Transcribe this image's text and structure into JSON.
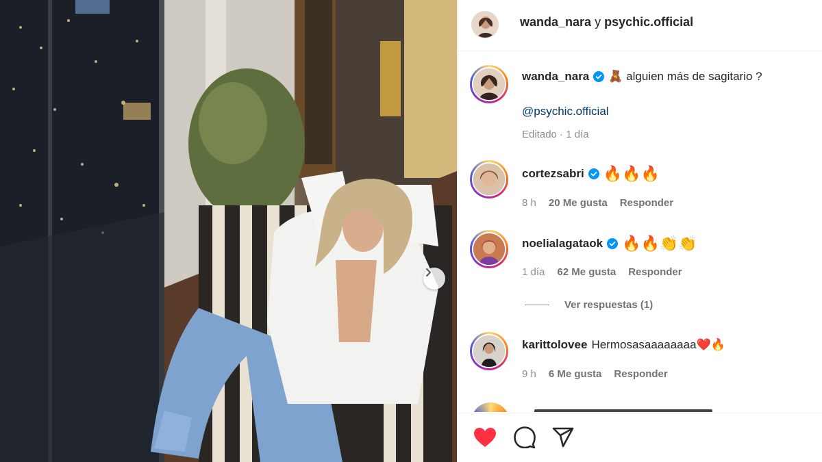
{
  "header": {
    "user1": "wanda_nara",
    "joiner": "y",
    "user2": "psychic.official"
  },
  "caption": {
    "username": "wanda_nara",
    "text": "🧸 alguien más de sagitario ?",
    "mention": "@psychic.official",
    "meta": "Editado · 1 día"
  },
  "comments": [
    {
      "username": "cortezsabri",
      "verified": true,
      "text": "🔥🔥🔥",
      "time": "8 h",
      "likes": "20 Me gusta",
      "reply": "Responder"
    },
    {
      "username": "noelialagataok",
      "verified": true,
      "text": "🔥🔥👏👏",
      "time": "1 día",
      "likes": "62 Me gusta",
      "reply": "Responder"
    },
    {
      "username": "karittolovee",
      "verified": false,
      "text": "Hermosasaaaaaaaa❤️🔥",
      "time": "9 h",
      "likes": "6 Me gusta",
      "reply": "Responder"
    }
  ],
  "view_replies": "Ver respuestas (1)",
  "colors": {
    "like_red": "#ff3040",
    "verified_blue": "#0095f6",
    "link_blue": "#00376b",
    "meta_gray": "#8e8e8e"
  },
  "icons": {
    "like": "heart-filled-icon",
    "comment": "speech-bubble-icon",
    "share": "paper-plane-icon",
    "carousel_next": "chevron-right-icon"
  }
}
